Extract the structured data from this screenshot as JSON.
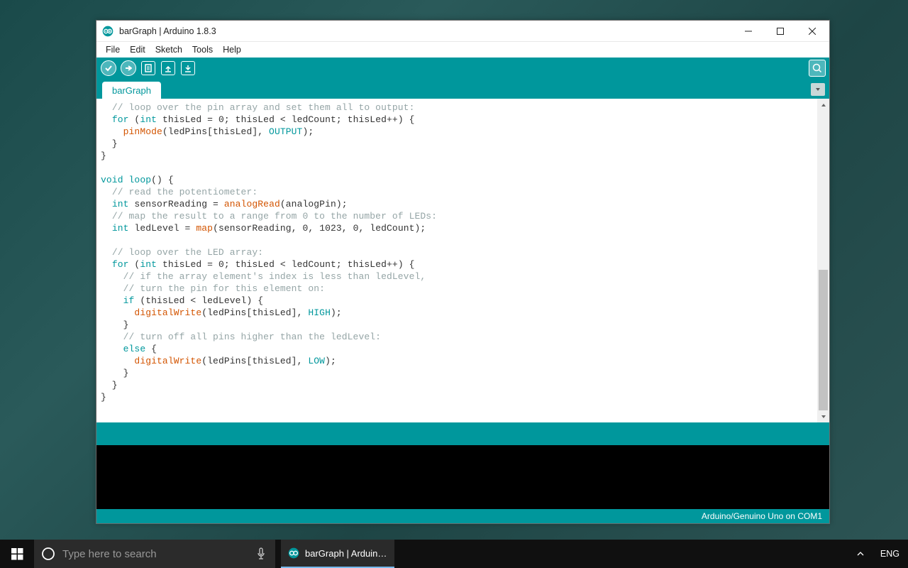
{
  "window": {
    "title": "barGraph | Arduino 1.8.3"
  },
  "menu": {
    "file": "File",
    "edit": "Edit",
    "sketch": "Sketch",
    "tools": "Tools",
    "help": "Help"
  },
  "tabs": {
    "main": "barGraph"
  },
  "code_tokens": [
    [
      [
        "  "
      ],
      [
        "// loop over the pin array and set them all to output:",
        "cmt"
      ]
    ],
    [
      [
        "  "
      ],
      [
        "for",
        "kw-teal"
      ],
      [
        " ("
      ],
      [
        "int",
        "kw-teal"
      ],
      [
        " thisLed = 0; thisLed < ledCount; thisLed++) {"
      ]
    ],
    [
      [
        "    "
      ],
      [
        "pinMode",
        "kw-fn"
      ],
      [
        "(ledPins[thisLed], "
      ],
      [
        "OUTPUT",
        "const"
      ],
      [
        ");"
      ]
    ],
    [
      [
        "  }"
      ]
    ],
    [
      [
        "}"
      ]
    ],
    [
      [
        ""
      ]
    ],
    [
      [
        "void",
        "kw-teal"
      ],
      [
        " "
      ],
      [
        "loop",
        "kw-teal"
      ],
      [
        "() {"
      ]
    ],
    [
      [
        "  "
      ],
      [
        "// read the potentiometer:",
        "cmt"
      ]
    ],
    [
      [
        "  "
      ],
      [
        "int",
        "kw-teal"
      ],
      [
        " sensorReading = "
      ],
      [
        "analogRead",
        "kw-fn"
      ],
      [
        "(analogPin);"
      ]
    ],
    [
      [
        "  "
      ],
      [
        "// map the result to a range from 0 to the number of LEDs:",
        "cmt"
      ]
    ],
    [
      [
        "  "
      ],
      [
        "int",
        "kw-teal"
      ],
      [
        " ledLevel = "
      ],
      [
        "map",
        "kw-fn"
      ],
      [
        "(sensorReading, 0, 1023, 0, ledCount);"
      ]
    ],
    [
      [
        ""
      ]
    ],
    [
      [
        "  "
      ],
      [
        "// loop over the LED array:",
        "cmt"
      ]
    ],
    [
      [
        "  "
      ],
      [
        "for",
        "kw-teal"
      ],
      [
        " ("
      ],
      [
        "int",
        "kw-teal"
      ],
      [
        " thisLed = 0; thisLed < ledCount; thisLed++) {"
      ]
    ],
    [
      [
        "    "
      ],
      [
        "// if the array element's index is less than ledLevel,",
        "cmt"
      ]
    ],
    [
      [
        "    "
      ],
      [
        "// turn the pin for this element on:",
        "cmt"
      ]
    ],
    [
      [
        "    "
      ],
      [
        "if",
        "kw-teal"
      ],
      [
        " (thisLed < ledLevel) {"
      ]
    ],
    [
      [
        "      "
      ],
      [
        "digitalWrite",
        "kw-fn"
      ],
      [
        "(ledPins[thisLed], "
      ],
      [
        "HIGH",
        "const"
      ],
      [
        ");"
      ]
    ],
    [
      [
        "    }"
      ]
    ],
    [
      [
        "    "
      ],
      [
        "// turn off all pins higher than the ledLevel:",
        "cmt"
      ]
    ],
    [
      [
        "    "
      ],
      [
        "else",
        "kw-teal"
      ],
      [
        " {"
      ]
    ],
    [
      [
        "      "
      ],
      [
        "digitalWrite",
        "kw-fn"
      ],
      [
        "(ledPins[thisLed], "
      ],
      [
        "LOW",
        "const"
      ],
      [
        ");"
      ]
    ],
    [
      [
        "    }"
      ]
    ],
    [
      [
        "  }"
      ]
    ],
    [
      [
        "}"
      ]
    ]
  ],
  "scroll": {
    "thumb_top_pct": 53,
    "thumb_height_pct": 47
  },
  "bottombar": {
    "board": "Arduino/Genuino Uno on COM1"
  },
  "taskbar": {
    "search_placeholder": "Type here to search",
    "task_label": "barGraph | Arduino...",
    "lang": "ENG"
  }
}
